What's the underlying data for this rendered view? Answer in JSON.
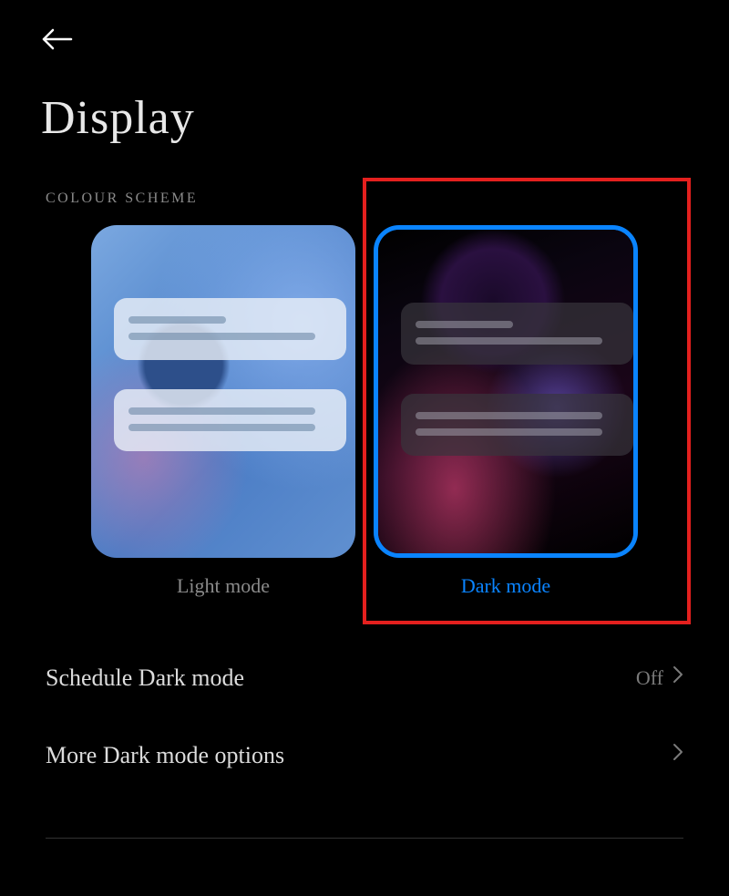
{
  "header": {
    "title": "Display"
  },
  "section": {
    "label": "COLOUR SCHEME"
  },
  "modes": {
    "light": {
      "label": "Light mode",
      "selected": false
    },
    "dark": {
      "label": "Dark mode",
      "selected": true
    }
  },
  "settings": {
    "schedule": {
      "label": "Schedule Dark mode",
      "value": "Off"
    },
    "more": {
      "label": "More Dark mode options"
    }
  },
  "colors": {
    "accent": "#0a84ff",
    "highlight": "#e4201e"
  }
}
